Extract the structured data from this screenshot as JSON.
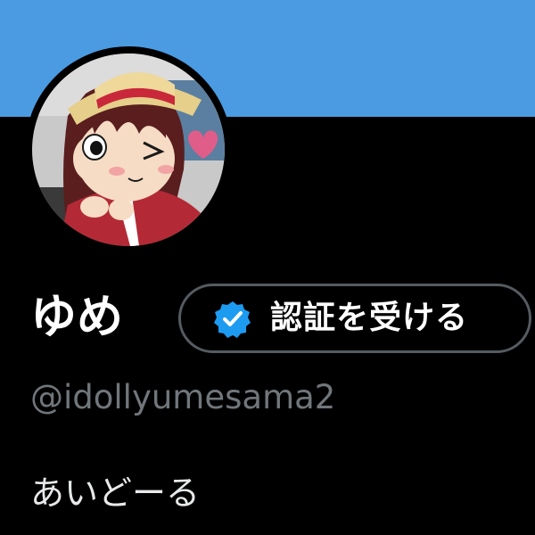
{
  "header": {
    "banner_color": "#4a9be2"
  },
  "profile": {
    "avatar_icon": "avatar-anime-girl-straw-hat",
    "display_name": "ゆめ",
    "verify_button": {
      "icon": "verified-badge-icon",
      "label": "認証を受ける",
      "badge_color": "#1d9bf0"
    },
    "handle": "@idollyumesama2",
    "bio": "あいどーる"
  },
  "colors": {
    "background": "#000000",
    "primary_text": "#ffffff",
    "secondary_text": "#71767b",
    "button_border": "#555b61"
  }
}
